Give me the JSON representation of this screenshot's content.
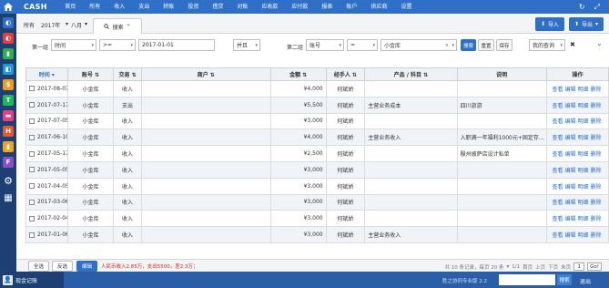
{
  "app": {
    "brand": "CASH"
  },
  "nav": [
    "首页",
    "所有",
    "收入",
    "支出",
    "转账",
    "投资",
    "借贷",
    "对账",
    "应收款",
    "应付款",
    "报表",
    "账户",
    "供应商",
    "设置"
  ],
  "tabbar": {
    "all": "所有",
    "year": "2017年",
    "month": "八月",
    "search_tab": "搜索",
    "import": "导入",
    "export": "导出"
  },
  "filter": {
    "group1_label": "第一组",
    "group1_field": "时间",
    "group1_op": ">=",
    "group1_value": "2017-01-01",
    "join": "并且",
    "group2_label": "第二组",
    "group2_field": "账号",
    "group2_op": "=",
    "group2_value": "小金库",
    "search": "搜索",
    "reset": "重置",
    "save": "保存",
    "my_query": "我的查询"
  },
  "table": {
    "headers": [
      "时间",
      "账号",
      "交易",
      "商户",
      "金额",
      "经手人",
      "产品 / 科目",
      "说明",
      "操作"
    ],
    "ops": [
      "查看",
      "编辑",
      "明细",
      "删除"
    ],
    "rows": [
      {
        "date": "2017-08-07",
        "account": "小金库",
        "type": "收入",
        "merchant": "",
        "amount": "¥4,000",
        "handler": "何斌娇",
        "category": "",
        "note": ""
      },
      {
        "date": "2017-07-17",
        "account": "小金库",
        "type": "支出",
        "merchant": "",
        "amount": "¥5,500",
        "handler": "何斌娇",
        "category": "主营业务成本",
        "note": "四川旅游"
      },
      {
        "date": "2017-07-05",
        "account": "小金库",
        "type": "收入",
        "merchant": "",
        "amount": "¥3,000",
        "handler": "何斌娇",
        "category": "",
        "note": ""
      },
      {
        "date": "2017-06-10",
        "account": "小金库",
        "type": "收入",
        "merchant": "",
        "amount": "¥4,000",
        "handler": "何斌娇",
        "category": "主营业务收入",
        "note": "入职满一年福利1000元+固定存..."
      },
      {
        "date": "2017-05-17",
        "account": "小金库",
        "type": "收入",
        "merchant": "",
        "amount": "¥2,500",
        "handler": "何斌娇",
        "category": "",
        "note": "殷州披萨店设计私单"
      },
      {
        "date": "2017-05-05",
        "account": "小金库",
        "type": "收入",
        "merchant": "",
        "amount": "¥3,000",
        "handler": "何斌娇",
        "category": "",
        "note": ""
      },
      {
        "date": "2017-04-05",
        "account": "小金库",
        "type": "收入",
        "merchant": "",
        "amount": "¥3,000",
        "handler": "何斌娇",
        "category": "",
        "note": ""
      },
      {
        "date": "2017-03-06",
        "account": "小金库",
        "type": "收入",
        "merchant": "",
        "amount": "¥3,000",
        "handler": "何斌娇",
        "category": "",
        "note": ""
      },
      {
        "date": "2017-02-04",
        "account": "小金库",
        "type": "收入",
        "merchant": "",
        "amount": "¥3,000",
        "handler": "何斌娇",
        "category": "",
        "note": ""
      },
      {
        "date": "2017-01-06",
        "account": "小金库",
        "type": "收入",
        "merchant": "",
        "amount": "¥3,000",
        "handler": "何斌娇",
        "category": "主营业务收入",
        "note": ""
      }
    ]
  },
  "footer": {
    "select_all": "全选",
    "invert": "反选",
    "edit": "编辑",
    "summary": "人民币收入2.85万，支出5500，差2.3万；",
    "total": "共 10 条记录，每页 20 条",
    "page_info": "1/1",
    "first": "首页",
    "prev": "上页",
    "next": "下页",
    "last": "末页",
    "page_input": "1",
    "go": "Go!"
  },
  "status": {
    "app": "现金记账",
    "version": "胜之协同专业版 2.2",
    "search": "搜索",
    "exit": "退出"
  },
  "colors": {
    "primary": "#2f6fc7",
    "sidebar": "#1d3f73",
    "summary_red": "#d9251d"
  }
}
